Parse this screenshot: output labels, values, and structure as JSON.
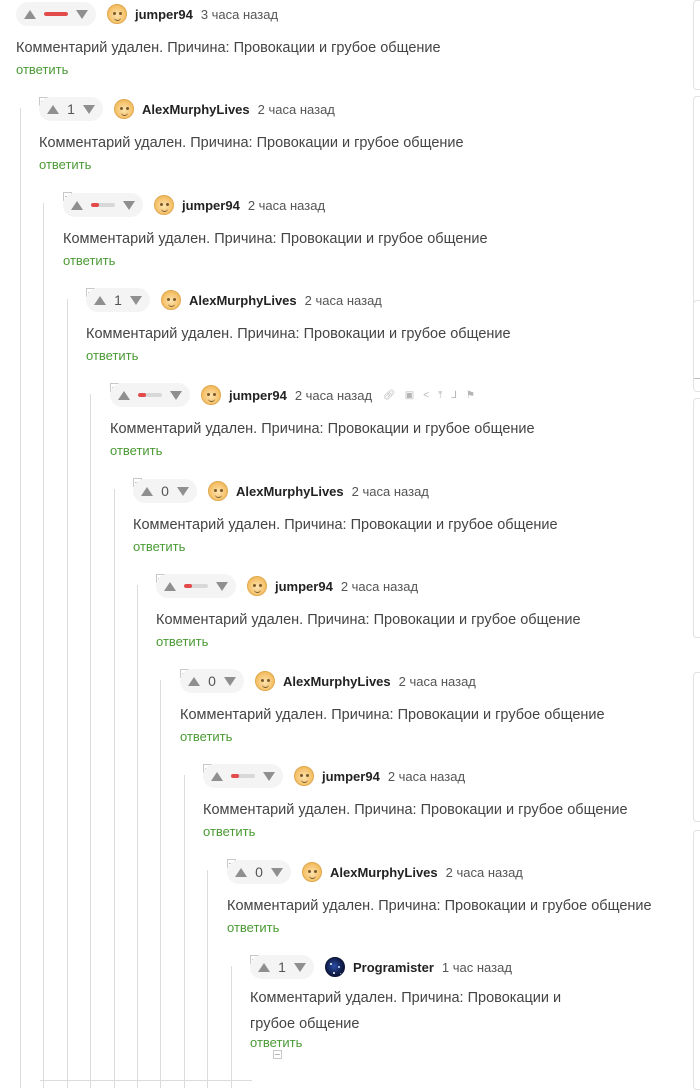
{
  "reply_label": "ответить",
  "deleted_text": "Комментарий удален. Причина: Провокации и грубое общение",
  "colors": {
    "accent_green": "#4a9a34",
    "minus_red": "#e34a4a"
  },
  "comments": [
    {
      "user": "jumper94",
      "time": "3 часа назад",
      "rating": "",
      "minus_fraction": 1.0,
      "avatar": "face"
    },
    {
      "user": "AlexMurphyLives",
      "time": "2 часа назад",
      "rating": "1",
      "avatar": "face"
    },
    {
      "user": "jumper94",
      "time": "2 часа назад",
      "rating": "",
      "minus_fraction": 0.35,
      "avatar": "face"
    },
    {
      "user": "AlexMurphyLives",
      "time": "2 часа назад",
      "rating": "1",
      "avatar": "face"
    },
    {
      "user": "jumper94",
      "time": "2 часа назад",
      "rating": "",
      "minus_fraction": 0.35,
      "avatar": "face",
      "tools": [
        "link-icon",
        "save-icon",
        "share-icon",
        "pin-icon",
        "branch-icon",
        "flag-icon"
      ]
    },
    {
      "user": "AlexMurphyLives",
      "time": "2 часа назад",
      "rating": "0",
      "avatar": "face"
    },
    {
      "user": "jumper94",
      "time": "2 часа назад",
      "rating": "",
      "minus_fraction": 0.35,
      "avatar": "face"
    },
    {
      "user": "AlexMurphyLives",
      "time": "2 часа назад",
      "rating": "0",
      "avatar": "face"
    },
    {
      "user": "jumper94",
      "time": "2 часа назад",
      "rating": "",
      "minus_fraction": 0.35,
      "avatar": "face"
    },
    {
      "user": "AlexMurphyLives",
      "time": "2 часа назад",
      "rating": "0",
      "avatar": "face"
    },
    {
      "user": "Programister",
      "time": "1 час назад",
      "rating": "1",
      "avatar": "space"
    }
  ]
}
